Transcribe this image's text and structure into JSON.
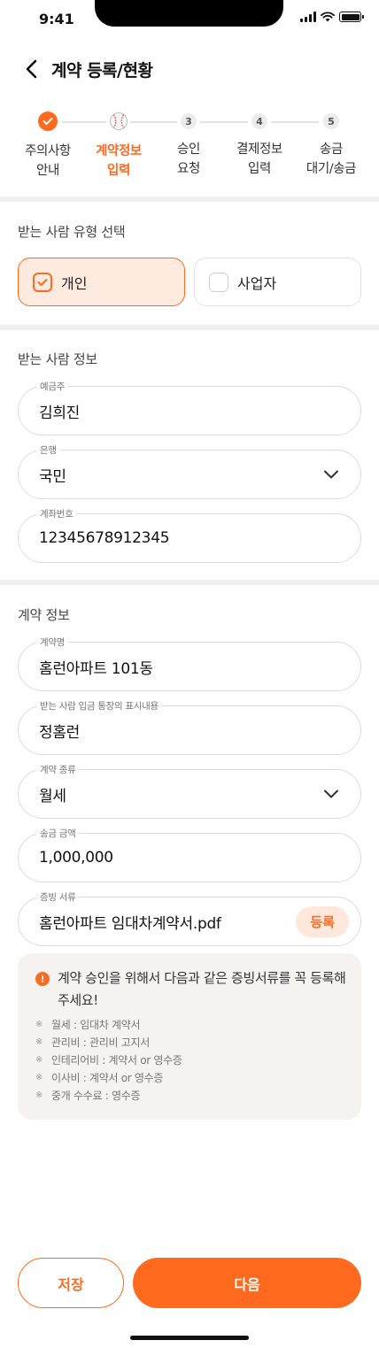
{
  "status_bar": {
    "time": "9:41"
  },
  "header": {
    "title": "계약 등록/현황"
  },
  "stepper": {
    "steps": [
      {
        "number": "",
        "label": "주의사항\n안내",
        "state": "done"
      },
      {
        "number": "",
        "label": "계약정보\n입력",
        "state": "current"
      },
      {
        "number": "3",
        "label": "승인\n요청",
        "state": "pending"
      },
      {
        "number": "4",
        "label": "결제정보\n입력",
        "state": "pending"
      },
      {
        "number": "5",
        "label": "송금\n대기/송금",
        "state": "pending"
      }
    ]
  },
  "recipient_type": {
    "section_title": "받는 사람 유형 선택",
    "options": [
      {
        "label": "개인",
        "selected": true
      },
      {
        "label": "사업자",
        "selected": false
      }
    ]
  },
  "recipient_info": {
    "section_title": "받는 사람 정보",
    "account_holder": {
      "label": "예금주",
      "value": "김희진"
    },
    "bank": {
      "label": "은행",
      "value": "국민"
    },
    "account_number": {
      "label": "계좌번호",
      "value": "12345678912345"
    }
  },
  "contract_info": {
    "section_title": "계약 정보",
    "contract_name": {
      "label": "계약명",
      "value": "홈런아파트 101동"
    },
    "display_text": {
      "label": "받는 사람 입금 통장의 표시내용",
      "value": "정홈런"
    },
    "contract_type": {
      "label": "계약 종류",
      "value": "월세"
    },
    "amount": {
      "label": "송금 금액",
      "value": "1,000,000"
    },
    "proof_document": {
      "label": "증빙 서류",
      "value": "홈런아파트 임대차계약서.pdf",
      "button_label": "등록"
    }
  },
  "notice": {
    "title": "계약 승인을 위해서 다음과 같은 증빙서류를 꼭 등록해 주세요!",
    "bullet": "※",
    "items": [
      "월세 : 임대차 계약서",
      "관리비 : 관리비 고지서",
      "인테리어비 : 계약서 or 영수증",
      "이사비 : 계약서 or 영수증",
      "중개 수수료 : 영수증"
    ]
  },
  "actions": {
    "save_label": "저장",
    "next_label": "다음"
  },
  "colors": {
    "accent": "#ff6a1e",
    "accent_light": "#ffeae0",
    "notice_bg": "#f5f2f0"
  },
  "icons": [
    "back-arrow-icon",
    "check-icon",
    "baseball-icon",
    "chevron-down-icon",
    "alert-icon"
  ]
}
